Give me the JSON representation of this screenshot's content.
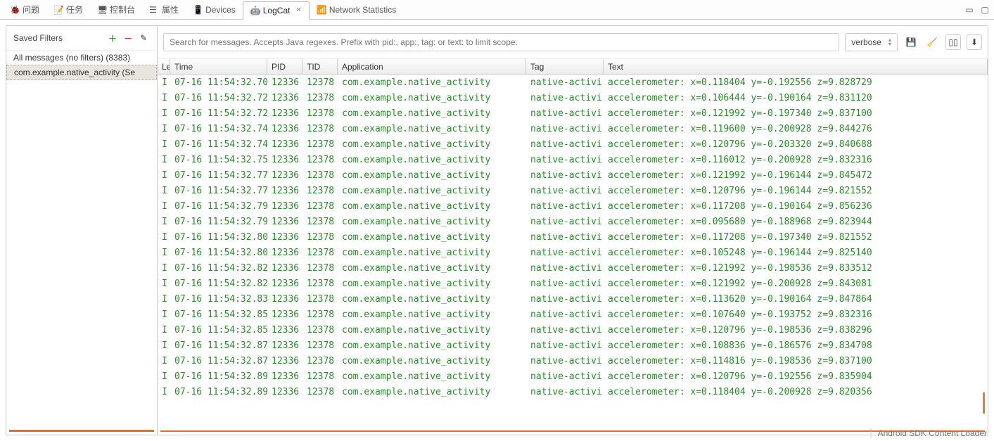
{
  "tabs": {
    "items": [
      {
        "label": "问题"
      },
      {
        "label": "任务"
      },
      {
        "label": "控制台"
      },
      {
        "label": "属性"
      },
      {
        "label": "Devices"
      },
      {
        "label": "LogCat"
      },
      {
        "label": "Network Statistics"
      }
    ],
    "close_glyph": "✕"
  },
  "sidebar": {
    "title": "Saved Filters",
    "items": [
      {
        "label": "All messages (no filters) (8383)"
      },
      {
        "label": "com.example.native_activity (Se"
      }
    ]
  },
  "search": {
    "placeholder": "Search for messages. Accepts Java regexes. Prefix with pid:, app:, tag: or text: to limit scope."
  },
  "level": {
    "selected": "verbose"
  },
  "columns": {
    "level": "Le",
    "time": "Time",
    "pid": "PID",
    "tid": "TID",
    "app": "Application",
    "tag": "Tag",
    "text": "Text"
  },
  "rows": [
    {
      "l": "I",
      "t": "07-16 11:54:32.70",
      "p": "12336",
      "d": "12378",
      "a": "com.example.native_activity",
      "g": "native-activi",
      "x": "accelerometer: x=0.118404 y=-0.192556 z=9.828729"
    },
    {
      "l": "I",
      "t": "07-16 11:54:32.72",
      "p": "12336",
      "d": "12378",
      "a": "com.example.native_activity",
      "g": "native-activi",
      "x": "accelerometer: x=0.106444 y=-0.190164 z=9.831120"
    },
    {
      "l": "I",
      "t": "07-16 11:54:32.72",
      "p": "12336",
      "d": "12378",
      "a": "com.example.native_activity",
      "g": "native-activi",
      "x": "accelerometer: x=0.121992 y=-0.197340 z=9.837100"
    },
    {
      "l": "I",
      "t": "07-16 11:54:32.74",
      "p": "12336",
      "d": "12378",
      "a": "com.example.native_activity",
      "g": "native-activi",
      "x": "accelerometer: x=0.119600 y=-0.200928 z=9.844276"
    },
    {
      "l": "I",
      "t": "07-16 11:54:32.74",
      "p": "12336",
      "d": "12378",
      "a": "com.example.native_activity",
      "g": "native-activi",
      "x": "accelerometer: x=0.120796 y=-0.203320 z=9.840688"
    },
    {
      "l": "I",
      "t": "07-16 11:54:32.75",
      "p": "12336",
      "d": "12378",
      "a": "com.example.native_activity",
      "g": "native-activi",
      "x": "accelerometer: x=0.116012 y=-0.200928 z=9.832316"
    },
    {
      "l": "I",
      "t": "07-16 11:54:32.77",
      "p": "12336",
      "d": "12378",
      "a": "com.example.native_activity",
      "g": "native-activi",
      "x": "accelerometer: x=0.121992 y=-0.196144 z=9.845472"
    },
    {
      "l": "I",
      "t": "07-16 11:54:32.77",
      "p": "12336",
      "d": "12378",
      "a": "com.example.native_activity",
      "g": "native-activi",
      "x": "accelerometer: x=0.120796 y=-0.196144 z=9.821552"
    },
    {
      "l": "I",
      "t": "07-16 11:54:32.79",
      "p": "12336",
      "d": "12378",
      "a": "com.example.native_activity",
      "g": "native-activi",
      "x": "accelerometer: x=0.117208 y=-0.190164 z=9.856236"
    },
    {
      "l": "I",
      "t": "07-16 11:54:32.79",
      "p": "12336",
      "d": "12378",
      "a": "com.example.native_activity",
      "g": "native-activi",
      "x": "accelerometer: x=0.095680 y=-0.188968 z=9.823944"
    },
    {
      "l": "I",
      "t": "07-16 11:54:32.80",
      "p": "12336",
      "d": "12378",
      "a": "com.example.native_activity",
      "g": "native-activi",
      "x": "accelerometer: x=0.117208 y=-0.197340 z=9.821552"
    },
    {
      "l": "I",
      "t": "07-16 11:54:32.80",
      "p": "12336",
      "d": "12378",
      "a": "com.example.native_activity",
      "g": "native-activi",
      "x": "accelerometer: x=0.105248 y=-0.196144 z=9.825140"
    },
    {
      "l": "I",
      "t": "07-16 11:54:32.82",
      "p": "12336",
      "d": "12378",
      "a": "com.example.native_activity",
      "g": "native-activi",
      "x": "accelerometer: x=0.121992 y=-0.198536 z=9.833512"
    },
    {
      "l": "I",
      "t": "07-16 11:54:32.82",
      "p": "12336",
      "d": "12378",
      "a": "com.example.native_activity",
      "g": "native-activi",
      "x": "accelerometer: x=0.121992 y=-0.200928 z=9.843081"
    },
    {
      "l": "I",
      "t": "07-16 11:54:32.83",
      "p": "12336",
      "d": "12378",
      "a": "com.example.native_activity",
      "g": "native-activi",
      "x": "accelerometer: x=0.113620 y=-0.190164 z=9.847864"
    },
    {
      "l": "I",
      "t": "07-16 11:54:32.85",
      "p": "12336",
      "d": "12378",
      "a": "com.example.native_activity",
      "g": "native-activi",
      "x": "accelerometer: x=0.107640 y=-0.193752 z=9.832316"
    },
    {
      "l": "I",
      "t": "07-16 11:54:32.85",
      "p": "12336",
      "d": "12378",
      "a": "com.example.native_activity",
      "g": "native-activi",
      "x": "accelerometer: x=0.120796 y=-0.198536 z=9.838296"
    },
    {
      "l": "I",
      "t": "07-16 11:54:32.87",
      "p": "12336",
      "d": "12378",
      "a": "com.example.native_activity",
      "g": "native-activi",
      "x": "accelerometer: x=0.108836 y=-0.186576 z=9.834708"
    },
    {
      "l": "I",
      "t": "07-16 11:54:32.87",
      "p": "12336",
      "d": "12378",
      "a": "com.example.native_activity",
      "g": "native-activi",
      "x": "accelerometer: x=0.114816 y=-0.198536 z=9.837100"
    },
    {
      "l": "I",
      "t": "07-16 11:54:32.89",
      "p": "12336",
      "d": "12378",
      "a": "com.example.native_activity",
      "g": "native-activi",
      "x": "accelerometer: x=0.120796 y=-0.192556 z=9.835904"
    },
    {
      "l": "I",
      "t": "07-16 11:54:32.89",
      "p": "12336",
      "d": "12378",
      "a": "com.example.native_activity",
      "g": "native-activi",
      "x": "accelerometer: x=0.118404 y=-0.200928 z=9.820356"
    }
  ],
  "status": {
    "text": "Android SDK Content Loader"
  }
}
